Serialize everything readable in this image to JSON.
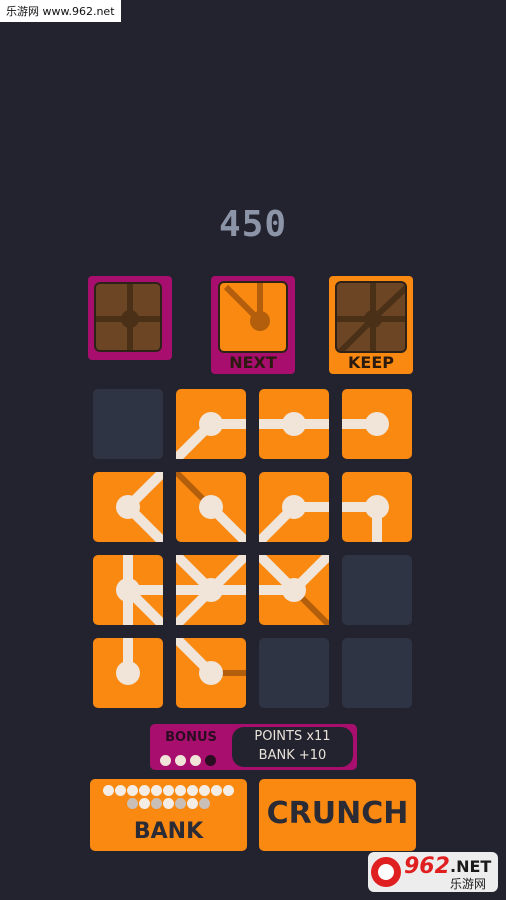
{
  "watermark": "乐游网 www.962.net",
  "score": "450",
  "preview": {
    "next_label": "NEXT",
    "keep_label": "KEEP"
  },
  "colors": {
    "background": "#23232f",
    "tile_orange": "#f98911",
    "slot_empty": "#2f3444",
    "magenta": "#a80e6d",
    "pipe_light": "#f1e4d8",
    "pipe_dark": "#b35e0c"
  },
  "board": {
    "rows": 4,
    "cols": 4,
    "cells": [
      {
        "filled": false
      },
      {
        "filled": true,
        "lit": [
          "E",
          "SW"
        ],
        "dim": []
      },
      {
        "filled": true,
        "lit": [
          "W",
          "E"
        ],
        "dim": []
      },
      {
        "filled": true,
        "lit": [
          "W"
        ],
        "dim": []
      },
      {
        "filled": true,
        "lit": [
          "NE",
          "SE"
        ],
        "dim": []
      },
      {
        "filled": true,
        "lit": [
          "SE"
        ],
        "dim": [
          "NW"
        ]
      },
      {
        "filled": true,
        "lit": [
          "E",
          "SW"
        ],
        "dim": []
      },
      {
        "filled": true,
        "lit": [
          "W",
          "S"
        ],
        "dim": []
      },
      {
        "filled": true,
        "lit": [
          "N",
          "E",
          "S",
          "SE"
        ],
        "dim": []
      },
      {
        "filled": true,
        "lit": [
          "NW",
          "NE",
          "W",
          "E",
          "SW"
        ],
        "dim": []
      },
      {
        "filled": true,
        "lit": [
          "NW",
          "NE",
          "W"
        ],
        "dim": [
          "SE"
        ]
      },
      {
        "filled": false
      },
      {
        "filled": true,
        "lit": [
          "N"
        ],
        "dim": []
      },
      {
        "filled": true,
        "lit": [
          "NW"
        ],
        "dim": [
          "E"
        ]
      },
      {
        "filled": false
      },
      {
        "filled": false
      }
    ]
  },
  "bonus": {
    "label": "BONUS",
    "dots_filled": 3,
    "dots_total": 4,
    "points": "POINTS x11",
    "bank": "BANK +10"
  },
  "bank_button": {
    "label": "BANK",
    "dots_row1": 11,
    "dots_row2": 7
  },
  "crunch_button": {
    "label": "CRUNCH"
  },
  "logo": {
    "number": "962",
    "suffix": ".NET",
    "sub": "乐游网"
  }
}
